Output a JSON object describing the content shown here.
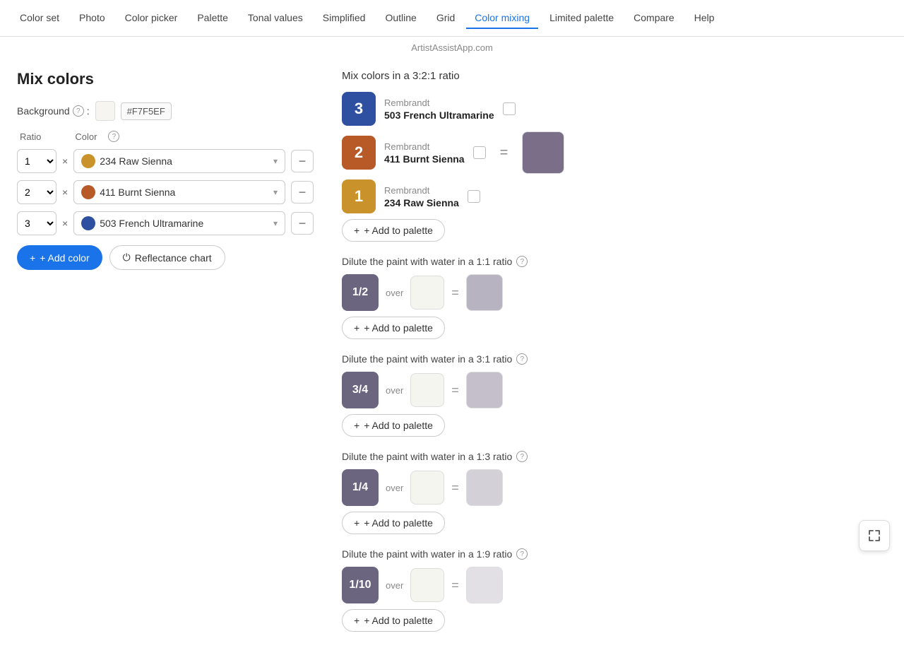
{
  "nav": {
    "items": [
      {
        "label": "Color set",
        "active": false
      },
      {
        "label": "Photo",
        "active": false
      },
      {
        "label": "Color picker",
        "active": false
      },
      {
        "label": "Palette",
        "active": false
      },
      {
        "label": "Tonal values",
        "active": false
      },
      {
        "label": "Simplified",
        "active": false
      },
      {
        "label": "Outline",
        "active": false
      },
      {
        "label": "Grid",
        "active": false
      },
      {
        "label": "Color mixing",
        "active": true
      },
      {
        "label": "Limited palette",
        "active": false
      },
      {
        "label": "Compare",
        "active": false
      },
      {
        "label": "Help",
        "active": false
      }
    ]
  },
  "subtitle": "ArtistAssistApp.com",
  "page": {
    "title": "Mix colors",
    "background_label": "Background",
    "background_hex": "#F7F5EF",
    "background_color": "#F7F5EF",
    "ratio_label": "Ratio",
    "x_label": "×",
    "color_label": "Color",
    "colors": [
      {
        "ratio": "1",
        "name": "234 Raw Sienna",
        "dot_color": "#C9922A",
        "id": "raw-sienna"
      },
      {
        "ratio": "2",
        "name": "411 Burnt Sienna",
        "dot_color": "#B85A28",
        "id": "burnt-sienna"
      },
      {
        "ratio": "3",
        "name": "503 French Ultramarine",
        "dot_color": "#2F4FA0",
        "id": "french-ultramarine"
      }
    ],
    "add_color_label": "+ Add color",
    "reflectance_label": "Reflectance chart"
  },
  "mix_section": {
    "title": "Mix colors in a 3:2:1 ratio",
    "cards": [
      {
        "ratio_num": "3",
        "brand": "Rembrandt",
        "name": "503 French Ultramarine",
        "badge_color": "#2F4FA0"
      },
      {
        "ratio_num": "2",
        "brand": "Rembrandt",
        "name": "411 Burnt Sienna",
        "badge_color": "#B85A28"
      },
      {
        "ratio_num": "1",
        "brand": "Rembrandt",
        "name": "234 Raw Sienna",
        "badge_color": "#C9922A"
      }
    ],
    "result_color": "#7A6E89",
    "add_palette_label": "+ Add to palette"
  },
  "dilutions": [
    {
      "title": "Dilute the paint with water in a 1:1 ratio",
      "fraction": "1/2",
      "badge_color": "#6b6580",
      "result_color": "#b8b3c0",
      "add_palette_label": "+ Add to palette"
    },
    {
      "title": "Dilute the paint with water in a 3:1 ratio",
      "fraction": "3/4",
      "badge_color": "#6b6580",
      "result_color": "#c4bfca",
      "add_palette_label": "+ Add to palette"
    },
    {
      "title": "Dilute the paint with water in a 1:3 ratio",
      "fraction": "1/4",
      "badge_color": "#6b6580",
      "result_color": "#d4d0d8",
      "add_palette_label": "+ Add to palette"
    },
    {
      "title": "Dilute the paint with water in a 1:9 ratio",
      "fraction": "1/10",
      "badge_color": "#6b6580",
      "result_color": "#e2e0e5",
      "add_palette_label": "+ Add to palette"
    }
  ]
}
